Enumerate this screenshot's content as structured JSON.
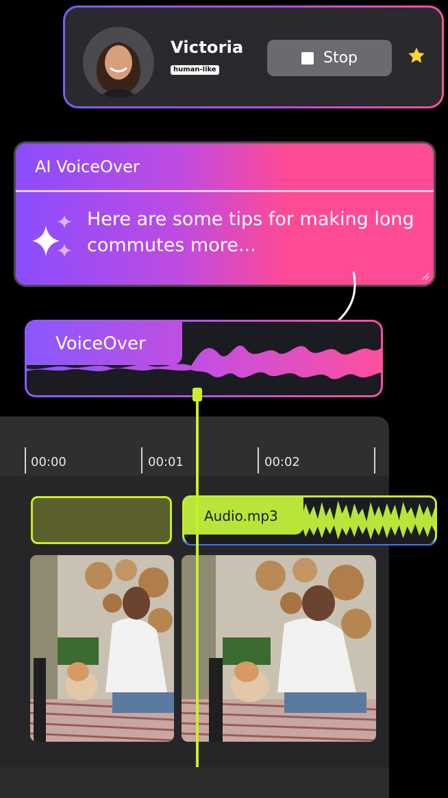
{
  "voice": {
    "name": "Victoria",
    "badge": "human-like",
    "stop_label": "Stop"
  },
  "ai_voiceover": {
    "title": "AI VoiceOver",
    "text": "Here are some tips for making long commutes more..."
  },
  "voiceover_track": {
    "label": "VoiceOver"
  },
  "timeline": {
    "ticks": [
      "00:00",
      "00:01",
      "00:02"
    ]
  },
  "audio_clip": {
    "label": "Audio.mp3"
  },
  "colors": {
    "accent_lime": "#c6f020",
    "gradient_purple": "#8a4dff",
    "gradient_pink": "#ff4a96",
    "star": "#ffd23a"
  },
  "icons": [
    "star-icon",
    "sparkle-icon",
    "stop-icon",
    "resize-handle-icon",
    "arrow-icon"
  ]
}
